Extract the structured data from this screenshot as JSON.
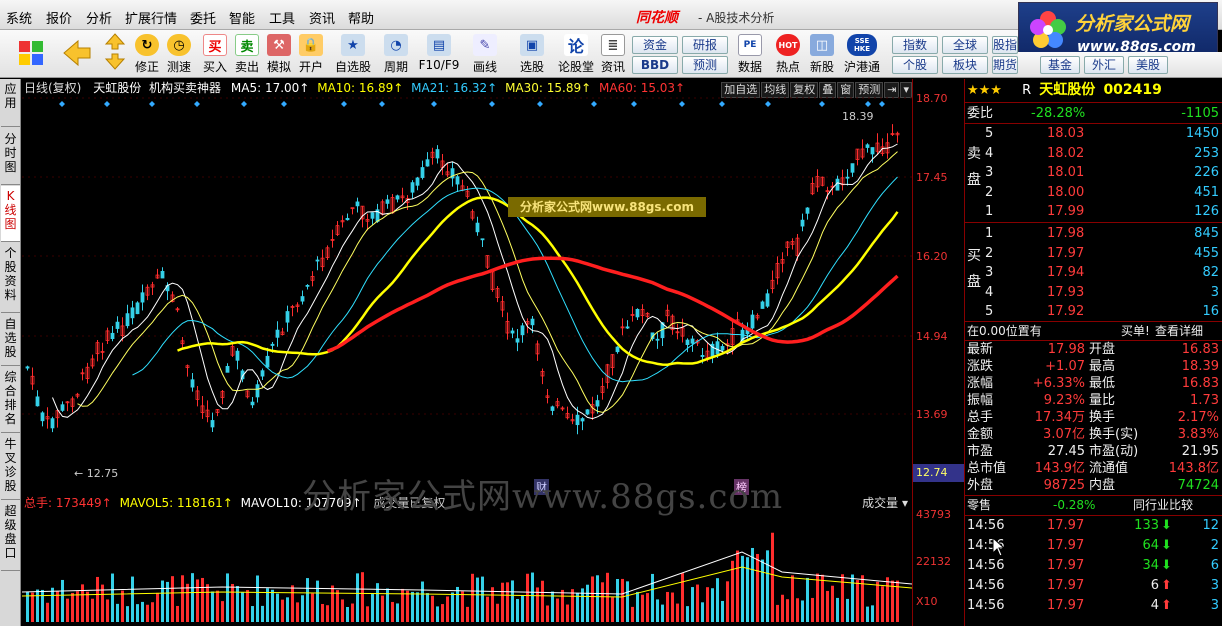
{
  "menu": [
    "系统",
    "报价",
    "分析",
    "扩展行情",
    "委托",
    "智能",
    "工具",
    "资讯",
    "帮助"
  ],
  "brand": "同花顺",
  "subtitle": "- A股技术分析",
  "logo": {
    "text": "分析家公式网",
    "url": "www.88gs.com"
  },
  "toolbar": [
    "修正",
    "测速",
    "买入",
    "卖出",
    "模拟",
    "开户",
    "自选股",
    "周期",
    "F10/F9",
    "画线",
    "选股",
    "论股堂",
    "资讯",
    "数据",
    "热点",
    "新股",
    "沪港通"
  ],
  "tool_icons": {
    "buy": "买",
    "sell": "卖",
    "lun": "论",
    "pe": "PE",
    "hot": "HOT",
    "sse": "SSE HKE"
  },
  "right_buttons_row1": [
    "资金",
    "研报",
    "指数",
    "全球",
    "股指"
  ],
  "right_buttons_row2": [
    "BBD",
    "预测",
    "个股",
    "板块",
    "期货",
    "基金",
    "外汇",
    "美股"
  ],
  "sidebar": [
    "应用",
    "分时图",
    "K线图",
    "个股资料",
    "自选股",
    "综合排名",
    "牛叉诊股",
    "超级盘口"
  ],
  "chart_header": {
    "mode": "日线(复权)",
    "name": "天虹股份",
    "indicator": "机构买卖神器",
    "ma5": "MA5: 17.00↑",
    "ma10": "MA10: 16.89↑",
    "ma21": "MA21: 16.32↑",
    "ma30": "MA30: 15.89↑",
    "ma60": "MA60: 15.03↑",
    "buttons": [
      "加自选",
      "均线",
      "复权",
      "叠",
      "窗",
      "预测"
    ]
  },
  "chart_labels": {
    "high": "18.39",
    "low": "12.75",
    "promo": "分析家公式网www.88gs.com",
    "cai": "财",
    "bang": "榜",
    "watermark": "分析家公式网www.88gs.com"
  },
  "y_ticks": [
    "18.70",
    "17.45",
    "16.20",
    "14.94",
    "13.69"
  ],
  "y_current": "12.74",
  "vol_header": {
    "total": "总手: 173449↑",
    "mavol5": "MAVOL5: 118161↑",
    "mavol10": "MAVOL10: 107709↑",
    "fq": "成交量已复权",
    "select": "成交量"
  },
  "vol_ticks": [
    "43793",
    "22132",
    "X10"
  ],
  "stock": {
    "star": "★★★",
    "flag": "R",
    "name": "天虹股份",
    "code": "002419"
  },
  "weibi": {
    "label": "委比",
    "pct": "-28.28%",
    "diff": "-1105"
  },
  "sell_label": "卖盘",
  "buy_label": "买盘",
  "asks": [
    {
      "lvl": "5",
      "price": "18.03",
      "vol": "1450"
    },
    {
      "lvl": "4",
      "price": "18.02",
      "vol": "253"
    },
    {
      "lvl": "3",
      "price": "18.01",
      "vol": "226"
    },
    {
      "lvl": "2",
      "price": "18.00",
      "vol": "451"
    },
    {
      "lvl": "1",
      "price": "17.99",
      "vol": "126"
    }
  ],
  "bids": [
    {
      "lvl": "1",
      "price": "17.98",
      "vol": "845"
    },
    {
      "lvl": "2",
      "price": "17.97",
      "vol": "455"
    },
    {
      "lvl": "3",
      "price": "17.94",
      "vol": "82"
    },
    {
      "lvl": "4",
      "price": "17.93",
      "vol": "3"
    },
    {
      "lvl": "5",
      "price": "17.92",
      "vol": "16"
    }
  ],
  "position": {
    "text": "在0.00位置有",
    "buy": "买单!",
    "detail": "查看详细"
  },
  "quote": [
    {
      "k1": "最新",
      "v1": "17.98",
      "k2": "开盘",
      "v2": "16.83"
    },
    {
      "k1": "涨跌",
      "v1": "+1.07",
      "k2": "最高",
      "v2": "18.39"
    },
    {
      "k1": "涨幅",
      "v1": "+6.33%",
      "k2": "最低",
      "v2": "16.83"
    },
    {
      "k1": "振幅",
      "v1": "9.23%",
      "k2": "量比",
      "v2": "1.73"
    },
    {
      "k1": "总手",
      "v1": "17.34万",
      "k2": "换手",
      "v2": "2.17%"
    },
    {
      "k1": "金额",
      "v1": "3.07亿",
      "k2": "换手(实)",
      "v2": "3.83%"
    },
    {
      "k1": "市盈",
      "v1": "27.45",
      "k2": "市盈(动)",
      "v2": "21.95"
    },
    {
      "k1": "总市值",
      "v1": "143.9亿",
      "k2": "流通值",
      "v2": "143.8亿"
    },
    {
      "k1": "外盘",
      "v1": "98725",
      "k2": "内盘",
      "v2": "74724"
    }
  ],
  "lingshou": {
    "label": "零售",
    "pct": "-0.28%",
    "compare": "同行业比较"
  },
  "ticks": [
    {
      "time": "14:56",
      "price": "17.97",
      "vol": "133",
      "dir": "down",
      "n": "12"
    },
    {
      "time": "14:56",
      "price": "17.97",
      "vol": "64",
      "dir": "down",
      "n": "2"
    },
    {
      "time": "14:56",
      "price": "17.97",
      "vol": "34",
      "dir": "down",
      "n": "6"
    },
    {
      "time": "14:56",
      "price": "17.97",
      "vol": "6",
      "dir": "up",
      "n": "3"
    },
    {
      "time": "14:56",
      "price": "17.97",
      "vol": "4",
      "dir": "up",
      "n": "3"
    }
  ]
}
